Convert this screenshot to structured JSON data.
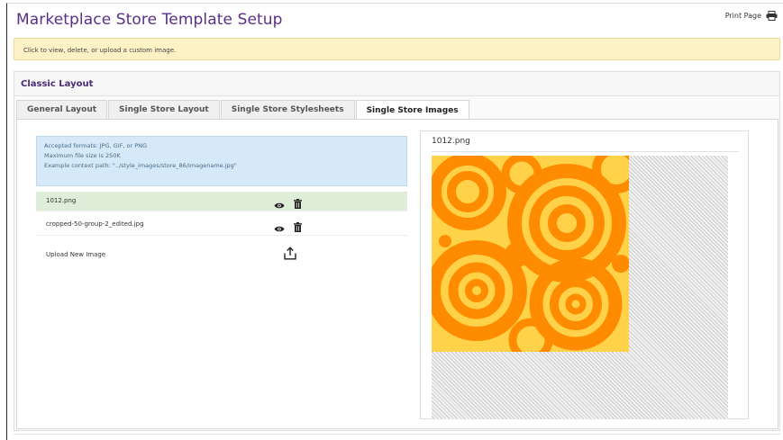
{
  "page": {
    "title": "Marketplace Store Template Setup"
  },
  "print": {
    "label": "Print Page",
    "icon": "printer-icon"
  },
  "notice": {
    "text": "Click to view, delete, or upload a custom image."
  },
  "panel": {
    "title": "Classic Layout",
    "tabs": [
      {
        "label": "General Layout"
      },
      {
        "label": "Single Store Layout"
      },
      {
        "label": "Single Store Stylesheets"
      },
      {
        "label": "Single Store Images",
        "active": true
      }
    ]
  },
  "info": {
    "formats": "Accepted formats: JPG, GIF, or PNG",
    "max_size": "Maximum file size is 250K",
    "example_path": "Example context path: \"../style_images/store_86/imagename.jpg\""
  },
  "files": [
    {
      "name": "1012.png",
      "selected": true,
      "view_icon": "eye-icon",
      "delete_icon": "trash-icon"
    },
    {
      "name": "cropped-50-group-2_edited.jpg",
      "selected": false,
      "view_icon": "eye-icon",
      "delete_icon": "trash-icon"
    }
  ],
  "upload": {
    "label": "Upload New Image",
    "icon": "upload-icon"
  },
  "preview": {
    "title": "1012.png"
  },
  "colors": {
    "title": "#5a2f8a",
    "notice_bg": "#fdf2c6",
    "info_bg": "#d6e9f8",
    "selected_row": "#dfeed8",
    "swirl_orange": "#ff8c00",
    "swirl_yellow": "#ffd24a"
  }
}
